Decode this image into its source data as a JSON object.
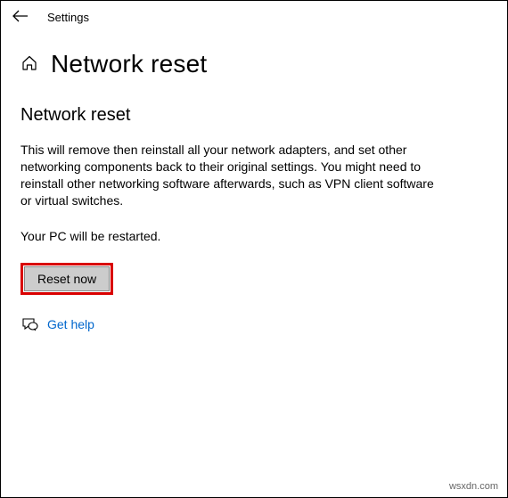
{
  "header": {
    "app_title": "Settings"
  },
  "title": {
    "page_title": "Network reset"
  },
  "content": {
    "section_heading": "Network reset",
    "description": "This will remove then reinstall all your network adapters, and set other networking components back to their original settings. You might need to reinstall other networking software afterwards, such as VPN client software or virtual switches.",
    "restart_note": "Your PC will be restarted.",
    "reset_button_label": "Reset now",
    "help_link_label": "Get help"
  },
  "watermark": "wsxdn.com"
}
